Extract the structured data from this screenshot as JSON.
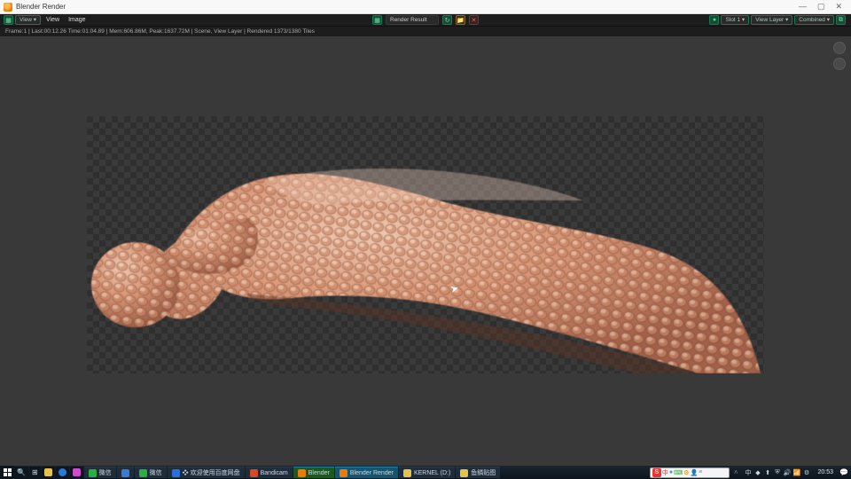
{
  "window": {
    "title": "Blender Render"
  },
  "header": {
    "left": {
      "icon_menu": "▦",
      "view_btn": "View ▾",
      "view_txt": "View",
      "image_txt": "Image"
    },
    "center": {
      "picker": "▦",
      "label": "Render Result",
      "refresh": "↻",
      "folder": "📁",
      "close": "✕"
    },
    "right": {
      "dot": "●",
      "slot": "Slot 1 ▾",
      "layer": "View Layer ▾",
      "pass": "Combined ▾",
      "channels": "⧉"
    }
  },
  "status": "Frame:1 | Last:00:12.26 Time:01:04.89 | Mem:606.86M, Peak:1637.72M | Scene, View Layer | Rendered 1373/1380 Tiles",
  "cursor_glyph": "➤",
  "taskbar": {
    "items": [
      {
        "label": "微信",
        "color": "#2aae3f"
      },
      {
        "label": "",
        "color": "#3a7bd5",
        "iconly": true
      },
      {
        "label": "微信",
        "color": "#2aae3f"
      },
      {
        "label": "❖ 欢迎使用百度网盘",
        "color": "#2a6fd5"
      },
      {
        "label": "Bandicam",
        "color": "#d24a2a"
      },
      {
        "label": "Blender",
        "color": "#eb7a0b",
        "active": true,
        "barcolor": "#1a5a1a"
      },
      {
        "label": "Blender Render",
        "color": "#eb7a0b",
        "active": true
      },
      {
        "label": "KERNEL (D:)",
        "color": "#e8c14a"
      },
      {
        "label": "鱼鳞贴图",
        "color": "#e8c14a"
      }
    ],
    "tray": {
      "icons": [
        "中",
        "◆",
        "⬆",
        "⛨",
        "🔊",
        "📶",
        "⚙"
      ],
      "time": "20:53"
    }
  }
}
